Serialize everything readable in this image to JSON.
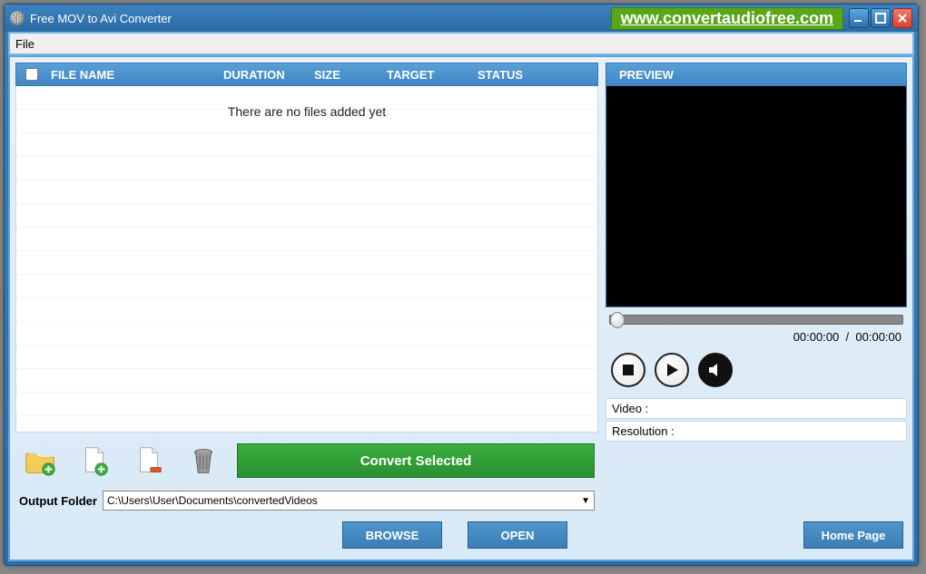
{
  "window": {
    "title": "Free MOV to Avi Converter",
    "promo_url": "www.convertaudiofree.com"
  },
  "menu": {
    "file": "File"
  },
  "table": {
    "headers": {
      "filename": "FILE NAME",
      "duration": "DURATION",
      "size": "SIZE",
      "target": "TARGET",
      "status": "STATUS"
    },
    "empty_message": "There are no files added yet"
  },
  "toolbar": {
    "convert_label": "Convert Selected"
  },
  "output": {
    "label": "Output Folder",
    "path": "C:\\Users\\User\\Documents\\convertedVideos",
    "browse": "BROWSE",
    "open": "OPEN"
  },
  "preview": {
    "header": "PREVIEW",
    "current_time": "00:00:00",
    "separator": "/",
    "total_time": "00:00:00",
    "video_label": "Video :",
    "resolution_label": "Resolution :"
  },
  "footer": {
    "home": "Home Page"
  }
}
